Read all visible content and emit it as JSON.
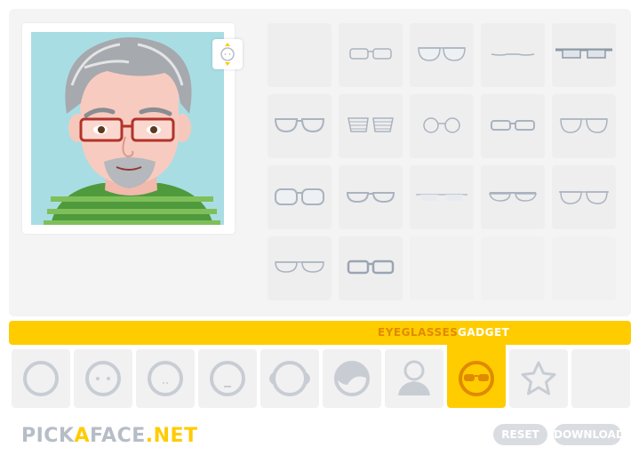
{
  "tabs": [
    {
      "label": "EYEGLASSES",
      "active": false
    },
    {
      "label": "GADGET",
      "active": true
    }
  ],
  "logo": {
    "part1": "PICK",
    "part2": "A",
    "part3": "FACE",
    "part4": ".NET"
  },
  "buttons": {
    "reset": "RESET",
    "download": "DOWNLOAD"
  },
  "categories": [
    "head",
    "eyes",
    "nose",
    "mouth",
    "ears",
    "hair",
    "clothes",
    "glasses",
    "extras",
    "empty"
  ],
  "glasses_options": [
    "none",
    "glasses-1",
    "glasses-2",
    "glasses-3",
    "glasses-4",
    "glasses-5",
    "glasses-6",
    "glasses-7",
    "glasses-8",
    "glasses-9",
    "glasses-10",
    "glasses-11",
    "glasses-12",
    "glasses-13",
    "glasses-14",
    "glasses-15",
    "glasses-16",
    "empty",
    "empty",
    "empty"
  ],
  "colors": {
    "accent": "#ffcc00",
    "accent_dark": "#e08a00",
    "avatar_bg": "#a9dde4",
    "button_gray": "#d9dde2"
  }
}
